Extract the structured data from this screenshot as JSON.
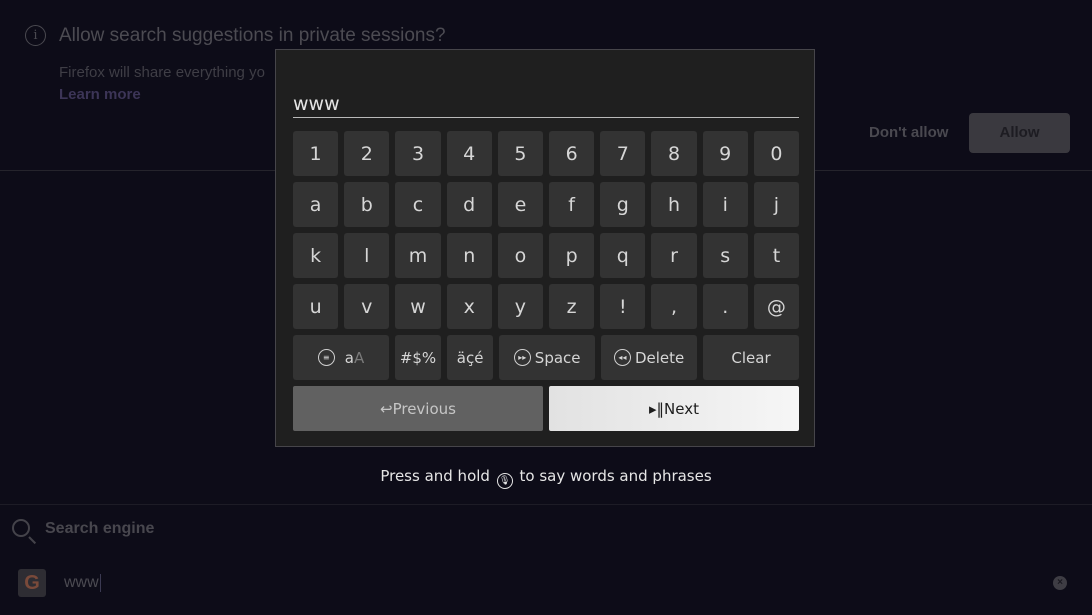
{
  "prompt": {
    "info_icon": "info-icon",
    "title": "Allow search suggestions in private sessions?",
    "body": "Firefox will share everything yo",
    "learn_more": "Learn more",
    "dont_allow": "Don't allow",
    "allow": "Allow"
  },
  "search": {
    "label": "Search engine",
    "engine_icon": "G",
    "url_value": "www",
    "clear_icon": "×"
  },
  "keyboard": {
    "input_value": "www",
    "rows": [
      [
        "1",
        "2",
        "3",
        "4",
        "5",
        "6",
        "7",
        "8",
        "9",
        "0"
      ],
      [
        "a",
        "b",
        "c",
        "d",
        "e",
        "f",
        "g",
        "h",
        "i",
        "j"
      ],
      [
        "k",
        "l",
        "m",
        "n",
        "o",
        "p",
        "q",
        "r",
        "s",
        "t"
      ],
      [
        "u",
        "v",
        "w",
        "x",
        "y",
        "z",
        "!",
        ",",
        ".",
        "@"
      ]
    ],
    "fn": {
      "case_lower": "a",
      "case_upper": "A",
      "symbols": "#$%",
      "accents": "äçé",
      "space": "Space",
      "delete": "Delete",
      "clear": "Clear"
    },
    "previous": "Previous",
    "next": "Next",
    "hint_before": "Press and hold",
    "hint_after": "to say words and phrases"
  }
}
